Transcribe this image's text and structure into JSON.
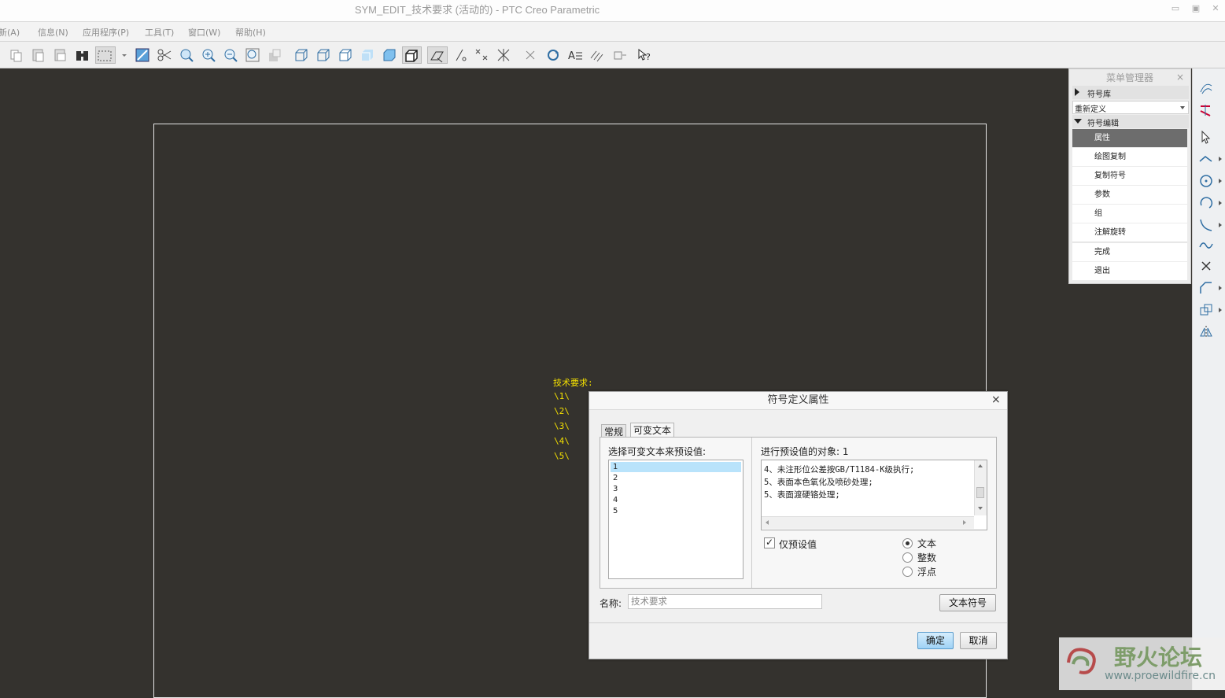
{
  "window": {
    "title": "SYM_EDIT_技术要求 (活动的) - PTC Creo Parametric"
  },
  "menubar": [
    "新(A)",
    "信息(N)",
    "应用程序(P)",
    "工具(T)",
    "窗口(W)",
    "帮助(H)"
  ],
  "toolbar": {
    "icons": [
      "copy-icon",
      "paste-icon",
      "paste-special-icon",
      "paste-alt-icon",
      "find-icon",
      "select-box-icon",
      "dropdown-arrow-icon",
      "draft-view-icon",
      "trim-icon",
      "zoom-area-icon",
      "zoom-in-icon",
      "zoom-out-icon",
      "refit-icon",
      "layer-icon",
      "view-wireframe-icon",
      "view-hidden-icon",
      "view-nohidden-icon",
      "view-shaded-icon",
      "view-shaded-edges-icon",
      "view-box-icon",
      "note-orient-icon",
      "sketch-line-icon",
      "points-icon",
      "axes-icon",
      "close-x-icon",
      "regenerate-icon",
      "text-style-icon",
      "hatch-icon",
      "symbol-icon",
      "help-icon"
    ]
  },
  "canvas": {
    "lines": [
      "技术要求:",
      "\\1\\",
      "\\2\\",
      "\\3\\",
      "\\4\\",
      "\\5\\"
    ]
  },
  "menu_manager": {
    "title": "菜单管理器",
    "close": "×",
    "symbol_lib": "符号库",
    "redefine": "重新定义",
    "symbol_edit": "符号编辑",
    "items": [
      "属性",
      "绘图复制",
      "复制符号",
      "参数",
      "组",
      "注解旋转",
      "完成",
      "退出"
    ],
    "selected_index": 0
  },
  "dialog": {
    "title": "符号定义属性",
    "close": "×",
    "tabs": [
      "常规",
      "可变文本"
    ],
    "active_tab": 1,
    "select_label": "选择可变文本来预设值:",
    "list_items": [
      "1",
      "2",
      "3",
      "4",
      "5"
    ],
    "selected_item": 0,
    "preset_label": "进行预设值的对象: 1",
    "preset_lines": [
      "4、未注形位公差按GB/T1184-K级执行;",
      "5、表面本色氧化及喷砂处理;",
      "5、表面渡硬铬处理;"
    ],
    "only_preset_label": "仅预设值",
    "only_preset_checked": true,
    "radios": [
      "文本",
      "整数",
      "浮点"
    ],
    "radio_selected": 0,
    "name_label": "名称:",
    "name_value": "技术要求",
    "text_symbol_button": "文本符号",
    "ok": "确定",
    "cancel": "取消"
  },
  "watermark": {
    "title": "野火论坛",
    "url": "www.proewildfire.cn"
  },
  "colors": {
    "background": "#34322e",
    "canvas_text": "#f4e000",
    "selection": "#b9e3fb"
  }
}
